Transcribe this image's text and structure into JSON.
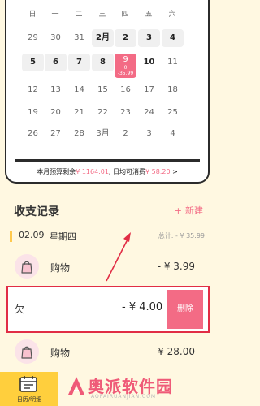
{
  "calendar": {
    "weekdays": [
      "日",
      "一",
      "二",
      "三",
      "四",
      "五",
      "六"
    ],
    "weeks": [
      [
        {
          "label": "29",
          "style": "plain"
        },
        {
          "label": "30",
          "style": "plain"
        },
        {
          "label": "31",
          "style": "plain"
        },
        {
          "label": "2月",
          "style": "cur"
        },
        {
          "label": "2",
          "style": "cur"
        },
        {
          "label": "3",
          "style": "cur"
        },
        {
          "label": "4",
          "style": "cur"
        }
      ],
      [
        {
          "label": "5",
          "style": "cur"
        },
        {
          "label": "6",
          "style": "cur"
        },
        {
          "label": "7",
          "style": "cur"
        },
        {
          "label": "8",
          "style": "cur"
        },
        {
          "label": "9",
          "style": "sel",
          "sub1": "0",
          "sub2": "-35.99"
        },
        {
          "label": "10",
          "style": "bold"
        },
        {
          "label": "11",
          "style": "plain"
        }
      ],
      [
        {
          "label": "12",
          "style": "plain"
        },
        {
          "label": "13",
          "style": "plain"
        },
        {
          "label": "14",
          "style": "plain"
        },
        {
          "label": "15",
          "style": "plain"
        },
        {
          "label": "16",
          "style": "plain"
        },
        {
          "label": "17",
          "style": "plain"
        },
        {
          "label": "18",
          "style": "plain"
        }
      ],
      [
        {
          "label": "19",
          "style": "plain"
        },
        {
          "label": "20",
          "style": "plain"
        },
        {
          "label": "21",
          "style": "plain"
        },
        {
          "label": "22",
          "style": "plain"
        },
        {
          "label": "23",
          "style": "plain"
        },
        {
          "label": "24",
          "style": "plain"
        },
        {
          "label": "25",
          "style": "plain"
        }
      ],
      [
        {
          "label": "26",
          "style": "plain"
        },
        {
          "label": "27",
          "style": "plain"
        },
        {
          "label": "28",
          "style": "plain"
        },
        {
          "label": "3月",
          "style": "plain"
        },
        {
          "label": "2",
          "style": "plain"
        },
        {
          "label": "3",
          "style": "plain"
        },
        {
          "label": "4",
          "style": "plain"
        }
      ]
    ],
    "budget": {
      "label": "本月预算剩余",
      "remaining": "¥ 1164.01",
      "daily_label": "日均可消费",
      "daily": "¥ 58.20",
      "chevron": ">"
    }
  },
  "records": {
    "title": "收支记录",
    "new_label": "新建",
    "new_icon": "+",
    "day": {
      "date": "02.09",
      "weekday": "星期四",
      "total": "总计: - ¥ 35.99"
    },
    "entries": [
      {
        "name": "购物",
        "amount": "- ¥ 3.99",
        "icon": "shopping-bag-icon"
      },
      {
        "name": "购物",
        "amount": "- ¥ 28.00",
        "icon": "shopping-bag-icon"
      }
    ],
    "swiped": {
      "name": "欠",
      "amount": "- ¥ 4.00",
      "delete_label": "删除"
    }
  },
  "bottom_nav": {
    "tab_label": "日历/明细",
    "tab_icon": "calendar-list-icon"
  },
  "watermark": {
    "brand": "奥派软件园",
    "url": "AOPAIRUANJIAN.COM"
  },
  "colors": {
    "accent": "#f36b85",
    "highlight": "#e12d45",
    "tab": "#ffcf3d",
    "background": "#fff8e1"
  }
}
